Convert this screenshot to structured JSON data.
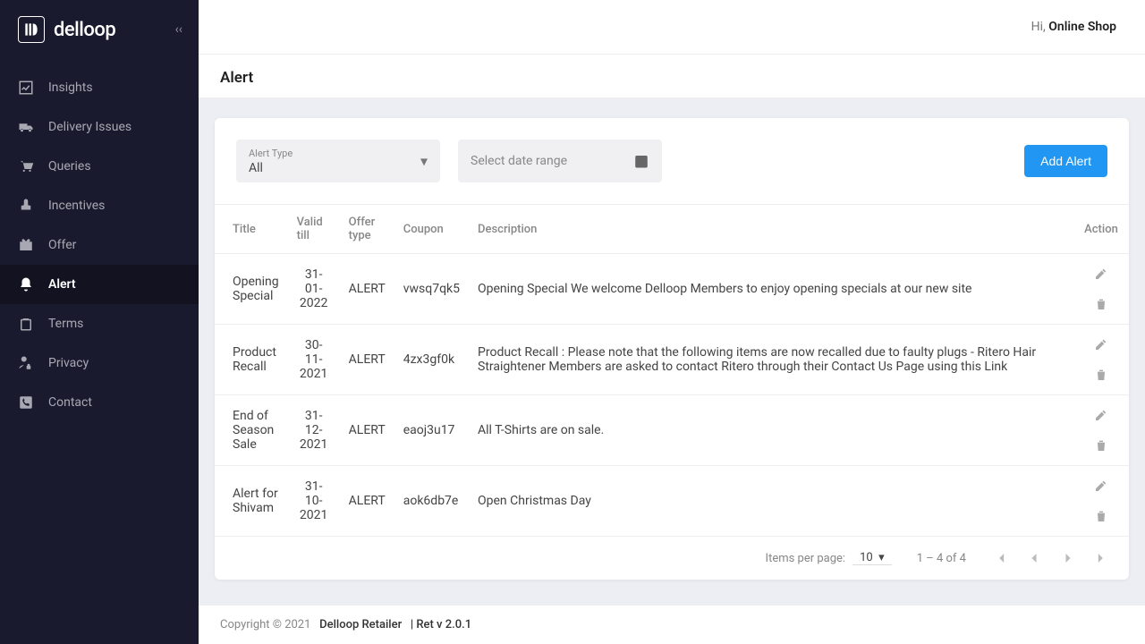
{
  "brand": "delloop",
  "greeting": {
    "hi": "Hi,",
    "name": "Online Shop"
  },
  "page_title": "Alert",
  "sidebar": {
    "items": [
      {
        "label": "Insights"
      },
      {
        "label": "Delivery Issues"
      },
      {
        "label": "Queries"
      },
      {
        "label": "Incentives"
      },
      {
        "label": "Offer"
      },
      {
        "label": "Alert"
      },
      {
        "label": "Terms"
      },
      {
        "label": "Privacy"
      },
      {
        "label": "Contact"
      }
    ]
  },
  "filters": {
    "alert_type_label": "Alert Type",
    "alert_type_value": "All",
    "date_placeholder": "Select date range"
  },
  "add_button": "Add Alert",
  "table": {
    "headers": {
      "title": "Title",
      "valid_till": "Valid till",
      "offer_type": "Offer type",
      "coupon": "Coupon",
      "description": "Description",
      "action": "Action"
    },
    "rows": [
      {
        "title": "Opening Special",
        "valid_till": "31-01-2022",
        "offer_type": "ALERT",
        "coupon": "vwsq7qk5",
        "description": "Opening Special We welcome Delloop Members to enjoy opening specials at our new site"
      },
      {
        "title": "Product Recall",
        "valid_till": "30-11-2021",
        "offer_type": "ALERT",
        "coupon": "4zx3gf0k",
        "description": "Product Recall : Please note that the following items are now recalled due to faulty plugs - Ritero Hair Straightener Members are asked to contact Ritero through their Contact Us Page using this Link"
      },
      {
        "title": "End of Season Sale",
        "valid_till": "31-12-2021",
        "offer_type": "ALERT",
        "coupon": "eaoj3u17",
        "description": "All T-Shirts are on sale."
      },
      {
        "title": "Alert for Shivam",
        "valid_till": "31-10-2021",
        "offer_type": "ALERT",
        "coupon": "aok6db7e",
        "description": "Open Christmas Day"
      }
    ]
  },
  "paginator": {
    "items_per_page_label": "Items per page:",
    "items_per_page_value": "10",
    "range": "1 – 4 of 4"
  },
  "footer": {
    "copyright": "Copyright © 2021",
    "product": "Delloop Retailer",
    "sep": "|",
    "version": "Ret v 2.0.1"
  }
}
